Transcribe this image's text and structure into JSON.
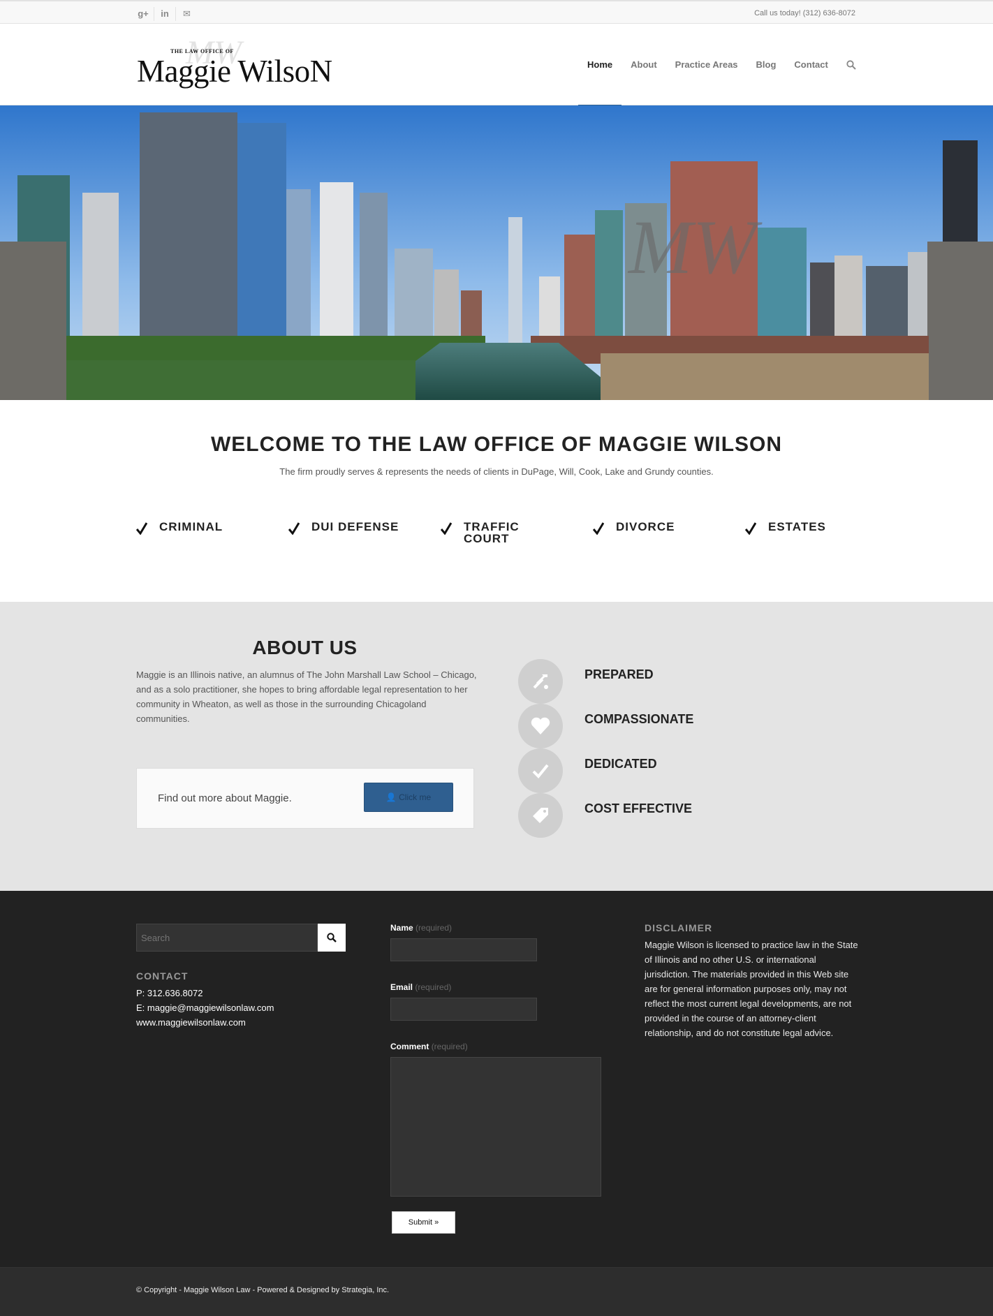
{
  "topbar": {
    "social_icons": [
      "google-plus-icon",
      "linkedin-icon",
      "mail-icon"
    ],
    "social_glyphs": [
      "g+",
      "in",
      "✉"
    ],
    "phone": "Call us today! (312) 636-8072"
  },
  "header": {
    "logo_small": "THE LAW OFFICE OF",
    "logo_big": "Maggie WilsoN",
    "logo_ghost": "MW",
    "nav": [
      "Home",
      "About",
      "Practice Areas",
      "Blog",
      "Contact"
    ],
    "active_nav": "Home"
  },
  "hero": {
    "watermark": "MW"
  },
  "welcome": {
    "title": "WELCOME TO THE LAW OFFICE OF MAGGIE WILSON",
    "subtitle": "The firm proudly serves & represents the needs of clients in DuPage, Will, Cook, Lake and Grundy counties.",
    "practice_areas": [
      "CRIMINAL",
      "DUI DEFENSE",
      "TRAFFIC COURT",
      "DIVORCE",
      "ESTATES"
    ]
  },
  "about": {
    "title": "ABOUT US",
    "text": "Maggie is an Illinois native, an alumnus of The John Marshall Law School – Chicago, and as a solo practitioner, she  hopes to bring affordable legal representation to her community in Wheaton, as well as those in the surrounding Chicagoland communities.",
    "cta_text": "Find out more about Maggie.",
    "cta_button": "Click me",
    "features": [
      {
        "label": "PREPARED",
        "icon": "tools-icon"
      },
      {
        "label": "COMPASSIONATE",
        "icon": "heart-icon"
      },
      {
        "label": "DEDICATED",
        "icon": "check-icon"
      },
      {
        "label": "COST EFFECTIVE",
        "icon": "tag-icon"
      }
    ]
  },
  "footer": {
    "search_placeholder": "Search",
    "contact_heading": "CONTACT",
    "phone": "P: 312.636.8072",
    "email": "E: maggie@maggiewilsonlaw.com",
    "website": "www.maggiewilsonlaw.com",
    "form": {
      "name_label": "Name",
      "email_label": "Email",
      "comment_label": "Comment",
      "required": "(required)",
      "submit": "Submit »"
    },
    "disclaimer_heading": "DISCLAIMER",
    "disclaimer_text": "Maggie Wilson is licensed to practice law in the State of Illinois and no other U.S. or international jurisdiction. The materials provided in this Web site are for general information purposes only, may not reflect the most current legal developments, are not provided in the course of an attorney-client relationship, and do not constitute legal advice."
  },
  "socket": {
    "copyright": "© Copyright - Maggie Wilson Law - Powered & Designed by Strategia, Inc."
  },
  "colors": {
    "accent": "#2f5f90",
    "footer_bg": "#222222",
    "about_bg": "#e4e4e4"
  }
}
